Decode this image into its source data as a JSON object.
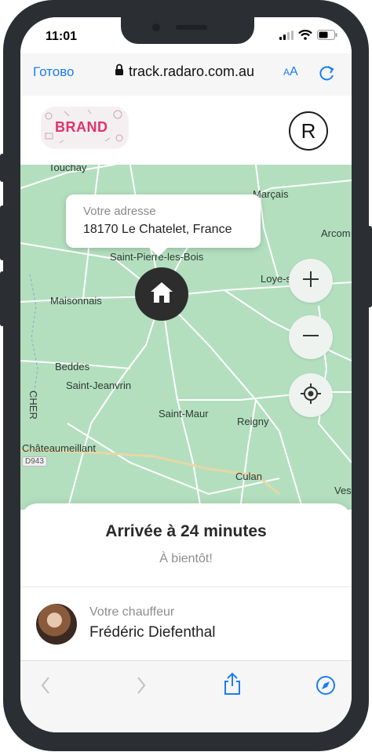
{
  "status_bar": {
    "time": "11:01"
  },
  "browser": {
    "done_label": "Готово",
    "url": "track.radaro.com.au",
    "text_size_label_small": "A",
    "text_size_label_large": "A"
  },
  "site": {
    "brand_logo_text": "BRAND",
    "badge_letter": "R"
  },
  "map": {
    "address_label": "Votre adresse",
    "address_value": "18170 Le Chatelet, France",
    "towns": [
      "Touchay",
      "Marçais",
      "Arcom",
      "Saint-Pierre-les-Bois",
      "Loye-sur-Arnon",
      "Maisonnais",
      "Beddes",
      "Saint-Jeanvrin",
      "CHER",
      "Saint-Maur",
      "Reigny",
      "Châteaumeillant",
      "Culan",
      "Ves"
    ],
    "road_label": "D943"
  },
  "delivery": {
    "eta": "Arrivée à 24 minutes",
    "farewell": "À bientôt!",
    "driver_label": "Votre chauffeur",
    "driver_name": "Frédéric Diefenthal"
  },
  "colors": {
    "accent": "#1a7ef0",
    "map_green": "#b3dfbf",
    "brand_pink": "#e6306a",
    "frame": "#2b2f33"
  }
}
